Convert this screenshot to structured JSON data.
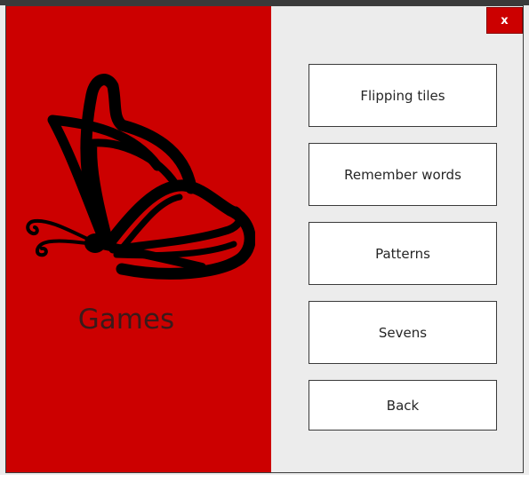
{
  "window": {
    "close_label": "x",
    "title": "Games"
  },
  "menu": {
    "items": [
      {
        "label": "Flipping tiles"
      },
      {
        "label": "Remember words"
      },
      {
        "label": "Patterns"
      },
      {
        "label": "Sevens"
      },
      {
        "label": "Back"
      }
    ]
  },
  "theme": {
    "accent": "#cc0000",
    "panel_bg": "#ececec",
    "button_bg": "#ffffff",
    "icon": "butterfly-icon"
  }
}
